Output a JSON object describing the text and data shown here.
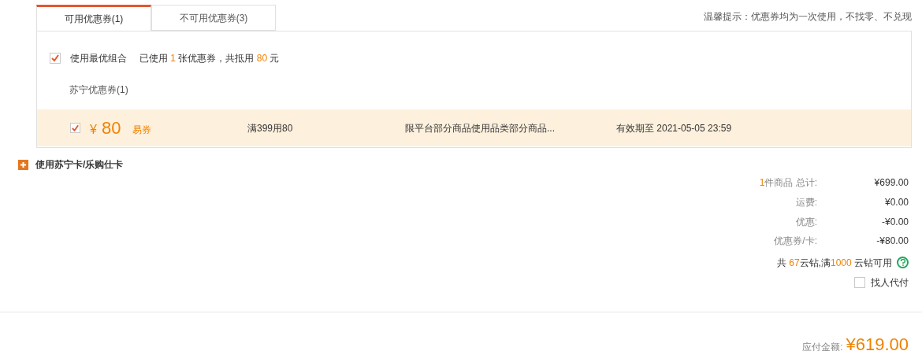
{
  "tabs": [
    {
      "label": "可用优惠券(1)",
      "selected": true
    },
    {
      "label": "不可用优惠券(3)",
      "selected": false
    }
  ],
  "hint": "温馨提示：优惠券均为一次使用，不找零、不兑现",
  "best_combo": {
    "checked": true,
    "label": "使用最优组合",
    "summary": [
      {
        "text": "已使用 ",
        "highlight": false
      },
      {
        "text": "1",
        "highlight": true
      },
      {
        "text": " 张优惠券，共抵用 ",
        "highlight": false
      },
      {
        "text": "80",
        "highlight": true
      },
      {
        "text": " 元",
        "highlight": false
      }
    ]
  },
  "group_title": "苏宁优惠券(1)",
  "coupons": [
    {
      "checked": true,
      "currency": "¥",
      "amount": "80",
      "type": "易券",
      "condition": "满399用80",
      "scope": "限平台部分商品使用品类部分商品...",
      "expiry": "有效期至 2021-05-05 23:59"
    }
  ],
  "card_section": {
    "expanded": false,
    "label": "使用苏宁卡/乐购仕卡"
  },
  "totals": [
    {
      "label": [
        {
          "text": "1",
          "highlight": true
        },
        {
          "text": "件商品 总计:",
          "highlight": false
        }
      ],
      "value": "¥699.00"
    },
    {
      "label": [
        {
          "text": "运费:",
          "highlight": false
        }
      ],
      "value": "¥0.00"
    },
    {
      "label": [
        {
          "text": "优惠:",
          "highlight": false
        }
      ],
      "value": "-¥0.00"
    },
    {
      "label": [
        {
          "text": "优惠券/卡:",
          "highlight": false
        }
      ],
      "value": "-¥80.00"
    }
  ],
  "diamonds": [
    {
      "text": "共 ",
      "highlight": false
    },
    {
      "text": "67",
      "highlight": true
    },
    {
      "text": "云钻,满",
      "highlight": false
    },
    {
      "text": "1000",
      "highlight": true
    },
    {
      "text": " 云钻可用",
      "highlight": false
    }
  ],
  "pay_for_me": {
    "checked": false,
    "label": "找人代付"
  },
  "amount_due": {
    "label": "应付金额:",
    "value": "¥619.00"
  }
}
